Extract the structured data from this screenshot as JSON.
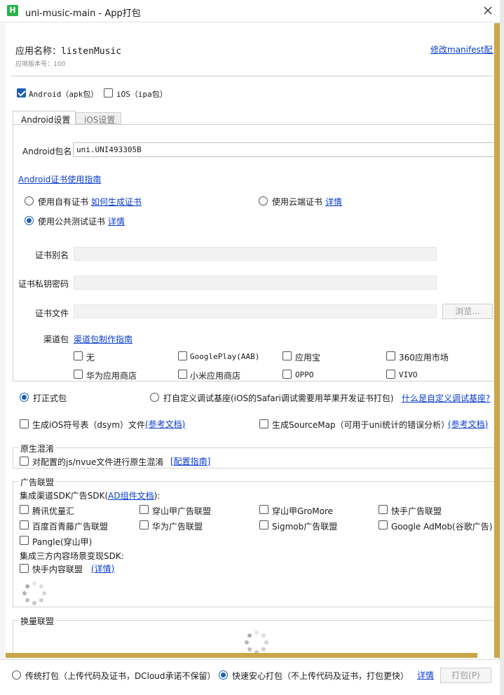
{
  "window": {
    "title": "uni-music-main - App打包",
    "logo": "H"
  },
  "app": {
    "name_label": "应用名称：listenMusic",
    "version_label": "应用版本号：100",
    "manifest_link": "修改manifest配置"
  },
  "platforms": [
    {
      "label": "Android（apk包）",
      "checked": true
    },
    {
      "label": "iOS（ipa包）",
      "checked": false
    }
  ],
  "tabs": [
    {
      "label": "Android设置",
      "active": true
    },
    {
      "label": "iOS设置",
      "active": false
    }
  ],
  "android": {
    "package_label": "Android包名",
    "package_value": "uni.UNI493305B",
    "cert_guide_link": "Android证书使用指南",
    "cert_options": {
      "own": {
        "label": "使用自有证书",
        "link": "如何生成证书",
        "selected": false
      },
      "cloud": {
        "label": "使用云端证书",
        "link": "详情",
        "selected": false
      },
      "public": {
        "label": "使用公共测试证书",
        "link": "详情",
        "selected": true
      }
    },
    "alias_label": "证书别名",
    "password_label": "证书私钥密码",
    "file_label": "证书文件",
    "browse_label": "浏览...",
    "channel_label": "渠道包",
    "channel_link": "渠道包制作指南",
    "channels": [
      "无",
      "GooglePlay(AAB)",
      "应用宝",
      "360应用市场",
      "华为应用商店",
      "小米应用商店",
      "OPPO",
      "VIVO"
    ]
  },
  "build_type": {
    "formal": {
      "label": "打正式包",
      "selected": true
    },
    "custom": {
      "label": "打自定义调试基座(iOS的Safari调试需要用苹果开发证书打包)",
      "selected": false
    },
    "custom_link": "什么是自定义调试基座?"
  },
  "options": {
    "dsym": {
      "label": "生成iOS符号表（dsym）文件",
      "link": "(参考文档)"
    },
    "sourcemap": {
      "label": "生成SourceMap（可用于uni统计的错误分析）",
      "link": "(参考文档)"
    }
  },
  "obfuscation": {
    "title": "原生混淆",
    "label": "对配置的js/nvue文件进行原生混淆",
    "link": "[配置指南]"
  },
  "ads": {
    "title": "广告联盟",
    "sdk_prefix": "集成渠道SDK广告SDK(",
    "sdk_link": "AD组件文档",
    "sdk_suffix": "):",
    "items": [
      "腾讯优量汇",
      "穿山甲广告联盟",
      "穿山甲GroMore",
      "快手广告联盟",
      "百度百青藤广告联盟",
      "华为广告联盟",
      "Sigmob广告联盟",
      "Google AdMob(谷歌广告)",
      "Pangle(穿山甲)"
    ],
    "content_title": "集成三方内容场景变现SDK:",
    "content_item": "快手内容联盟",
    "content_link": "(详情)"
  },
  "exchange": {
    "title": "换量联盟"
  },
  "footer": {
    "traditional": {
      "label": "传统打包（上传代码及证书，DCloud承诺不保留）",
      "selected": false
    },
    "fast": {
      "label": "快速安心打包（不上传代码及证书，打包更快）",
      "selected": true
    },
    "detail_link": "详情",
    "pack_button": "打包(P)"
  },
  "colors": {
    "accent": "#1a5fb4",
    "link": "#0a3dd1",
    "scrollbar": "#c8a74a"
  }
}
